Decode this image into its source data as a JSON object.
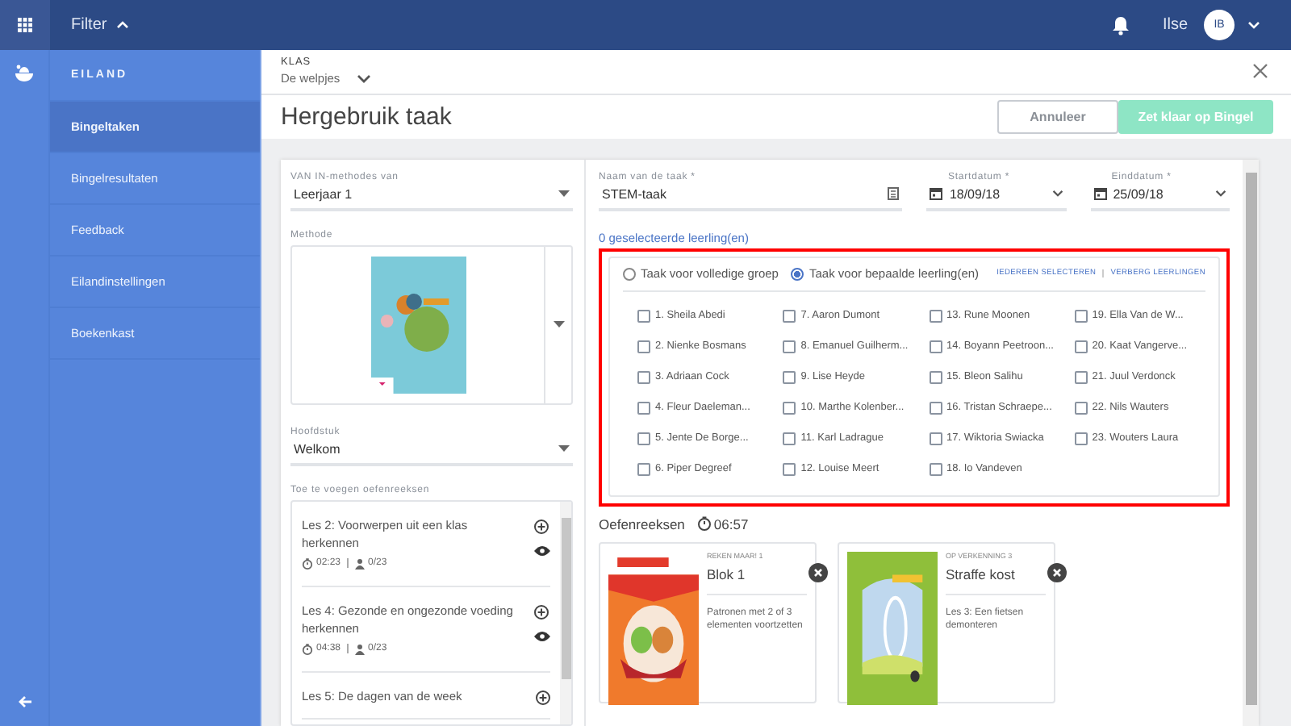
{
  "topbar": {
    "menu_label": "Filter",
    "user_name": "Ilse",
    "avatar_initials": "IB"
  },
  "sidebar": {
    "heading": "EILAND",
    "items": [
      {
        "label": "Bingeltaken",
        "selected": true
      },
      {
        "label": "Bingelresultaten",
        "selected": false
      },
      {
        "label": "Feedback",
        "selected": false
      },
      {
        "label": "Eilandinstellingen",
        "selected": false
      },
      {
        "label": "Boekenkast",
        "selected": false
      }
    ]
  },
  "class_picker": {
    "label": "KLAS",
    "value": "De welpjes"
  },
  "page": {
    "title": "Hergebruik taak",
    "buttons": [
      {
        "label": "Annuleer",
        "kind": "secondary"
      },
      {
        "label": "Zet klaar op Bingel",
        "kind": "primary"
      }
    ]
  },
  "left_panel": {
    "method_year": {
      "label": "VAN IN-methodes van",
      "value": "Leerjaar 1"
    },
    "method": {
      "label": "Methode"
    },
    "chapter": {
      "label": "Hoofdstuk",
      "value": "Welkom"
    },
    "series_list": {
      "label": "Toe te voegen oefenreeksen",
      "items": [
        {
          "title": "Les 2: Voorwerpen uit een klas herkennen",
          "duration": "02:23",
          "students": "0/23"
        },
        {
          "title": "Les 4: Gezonde en ongezonde voeding herkennen",
          "duration": "04:38",
          "students": "0/23"
        },
        {
          "title": "Les 5: De dagen van de week"
        }
      ]
    }
  },
  "task_form": {
    "name": {
      "label": "Naam van de taak *",
      "value": "STEM-taak"
    },
    "start": {
      "label": "Startdatum *",
      "value": "18/09/18"
    },
    "end": {
      "label": "Einddatum *",
      "value": "25/09/18"
    }
  },
  "students": {
    "selected_count": "0 geselecteerde leerling(en)",
    "modes": [
      {
        "label": "Taak voor volledige groep",
        "selected": false
      },
      {
        "label": "Taak voor bepaalde leerling(en)",
        "selected": true
      }
    ],
    "actions": [
      "IEDEREEN SELECTEREN",
      "VERBERG LEERLINGEN"
    ],
    "columns": [
      [
        {
          "name": "1. Sheila Abedi",
          "checked": false
        },
        {
          "name": "2. Nienke Bosmans",
          "checked": false
        },
        {
          "name": "3. Adriaan Cock",
          "checked": false
        },
        {
          "name": "4. Fleur Daeleman...",
          "checked": false
        },
        {
          "name": "5. Jente De Borge...",
          "checked": false
        },
        {
          "name": "6. Piper Degreef",
          "checked": false
        }
      ],
      [
        {
          "name": "7. Aaron Dumont",
          "checked": false
        },
        {
          "name": "8. Emanuel Guilherm...",
          "checked": false
        },
        {
          "name": "9. Lise Heyde",
          "checked": false
        },
        {
          "name": "10. Marthe Kolenber...",
          "checked": false
        },
        {
          "name": "11. Karl Ladrague",
          "checked": false
        },
        {
          "name": "12. Louise Meert",
          "checked": false
        }
      ],
      [
        {
          "name": "13. Rune Moonen",
          "checked": false
        },
        {
          "name": "14. Boyann Peetroon...",
          "checked": false
        },
        {
          "name": "15. Bleon Salihu",
          "checked": false
        },
        {
          "name": "16. Tristan Schraepe...",
          "checked": false
        },
        {
          "name": "17. Wiktoria Swiacka",
          "checked": false
        },
        {
          "name": "18. Io Vandeven",
          "checked": false
        }
      ],
      [
        {
          "name": "19. Ella Van de W...",
          "checked": false
        },
        {
          "name": "20. Kaat Vangerve...",
          "checked": false
        },
        {
          "name": "21. Juul Verdonck",
          "checked": false
        },
        {
          "name": "22. Nils Wauters",
          "checked": false
        },
        {
          "name": "23. Wouters Laura",
          "checked": false
        }
      ]
    ]
  },
  "exercise_series": {
    "title": "Oefenreeksen",
    "total_time": "06:57",
    "cards": [
      {
        "series": "REKEN MAAR! 1",
        "title": "Blok 1",
        "description": "Patronen met 2 of 3 elementen voortzetten"
      },
      {
        "series": "OP VERKENNING 3",
        "title": "Straffe kost",
        "description": "Les 3: Een fietsen demonteren"
      }
    ]
  }
}
